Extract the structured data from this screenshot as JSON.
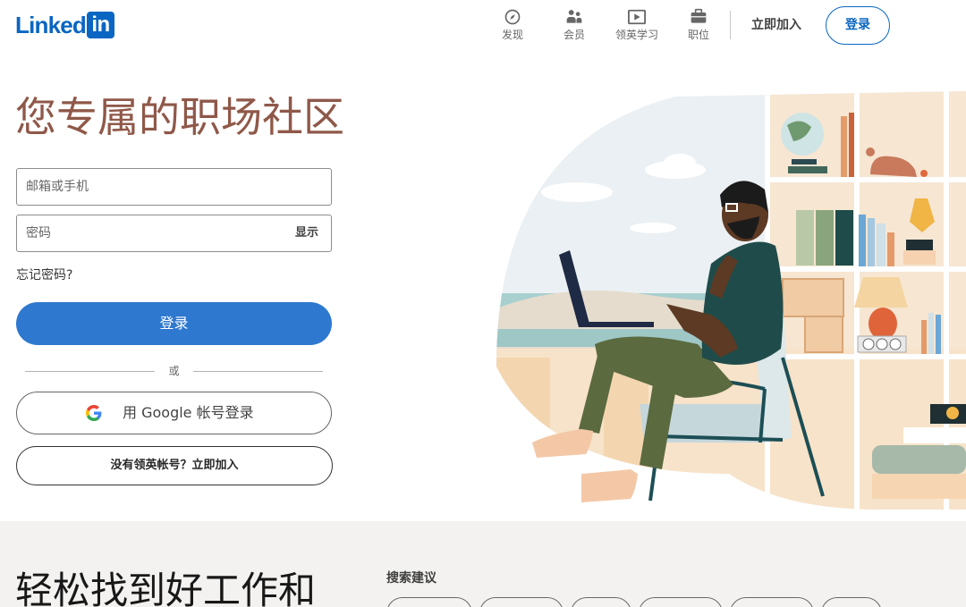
{
  "brand": {
    "logo_text": "Linked",
    "logo_box": "in",
    "color": "#0a66c2"
  },
  "nav": {
    "items": [
      {
        "label": "发现",
        "icon": "compass-icon"
      },
      {
        "label": "会员",
        "icon": "people-icon"
      },
      {
        "label": "领英学习",
        "icon": "play-video-icon"
      },
      {
        "label": "职位",
        "icon": "briefcase-icon"
      }
    ],
    "join_label": "立即加入",
    "signin_label": "登录"
  },
  "hero": {
    "title": "您专属的职场社区",
    "title_color": "#8f5849"
  },
  "form": {
    "email_placeholder": "邮箱或手机",
    "password_placeholder": "密码",
    "show_label": "显示",
    "forgot_label": "忘记密码?",
    "signin_button": "登录",
    "signin_button_color": "#2e78cf",
    "or_label": "或",
    "google_button": "用 Google 帐号登录",
    "join_button": "没有领英帐号？立即加入"
  },
  "bottom": {
    "title": "轻松找到好工作和",
    "suggestions_label": "搜索建议"
  }
}
